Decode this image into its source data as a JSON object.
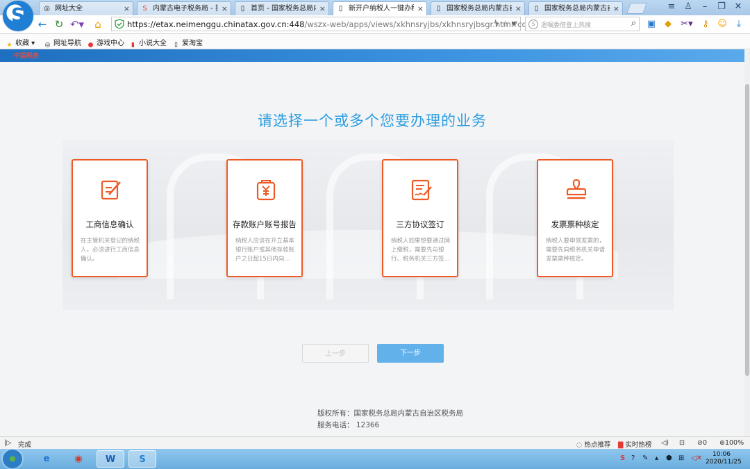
{
  "browser": {
    "tabs": [
      {
        "label": "网址大全",
        "icon": "globe-icon",
        "active": false
      },
      {
        "label": "内蒙古电子税务局 - 搜狗",
        "icon": "sogou-icon",
        "active": false
      },
      {
        "label": "首页 - 国家税务总局内蒙",
        "icon": "page-icon",
        "active": false
      },
      {
        "label": "新开户纳税人一键办税 -",
        "icon": "page-icon",
        "active": true
      },
      {
        "label": "国家税务总局内蒙古自治",
        "icon": "page-icon",
        "active": false
      },
      {
        "label": "国家税务总局内蒙古自治",
        "icon": "page-icon",
        "active": false
      }
    ],
    "close_glyph": "×",
    "url_host": "https://etax.neimenggu.chinatax.gov.cn:448",
    "url_path": "/wszx-web/apps/views/xkhnsryjbs/xkhnsryjbsgr.html?code",
    "search_placeholder": "遗嘱委借登上热搜",
    "bookmarks": [
      "收藏",
      "网址导航",
      "游戏中心",
      "小说大全",
      "爱淘宝"
    ]
  },
  "page": {
    "brand": "中国税务",
    "heading": "请选择一个或多个您要办理的业务",
    "cards": [
      {
        "title": "工商信息确认",
        "desc": "在主管机关登记的纳税人，必须进行工商信息确认。",
        "icon": "form-edit-icon"
      },
      {
        "title": "存款账户账号报告",
        "desc": "纳税人应该在开立基本银行账户或其他存款账户之日起15日内向...",
        "icon": "yuan-bag-icon"
      },
      {
        "title": "三方协议签订",
        "desc": "纳税人如果想要通过网上缴税，需要先与银行、税务机关三方签...",
        "icon": "contract-sign-icon"
      },
      {
        "title": "发票票种核定",
        "desc": "纳税人要申领发票的，需要先向税务机关申请发票票种核定。",
        "icon": "stamp-icon"
      }
    ],
    "prev_label": "上一步",
    "next_label": "下一步",
    "footer_copyright": "版权所有：国家税务总局内蒙古自治区税务局",
    "footer_phone": "服务电话： 12366"
  },
  "statusbar": {
    "status": "完成",
    "hot_recommend": "热点推荐",
    "realtime_hot": "实时热榜",
    "zoom": "100%",
    "count": "0"
  },
  "taskbar": {
    "time": "10:06",
    "date": "2020/11/25",
    "apps": [
      "ie-icon",
      "chrome-icon",
      "wps-icon",
      "sogou-browser-icon"
    ]
  },
  "colors": {
    "accent_blue": "#2c9ddf",
    "card_border": "#ee5a24",
    "next_button": "#63b1ea"
  }
}
